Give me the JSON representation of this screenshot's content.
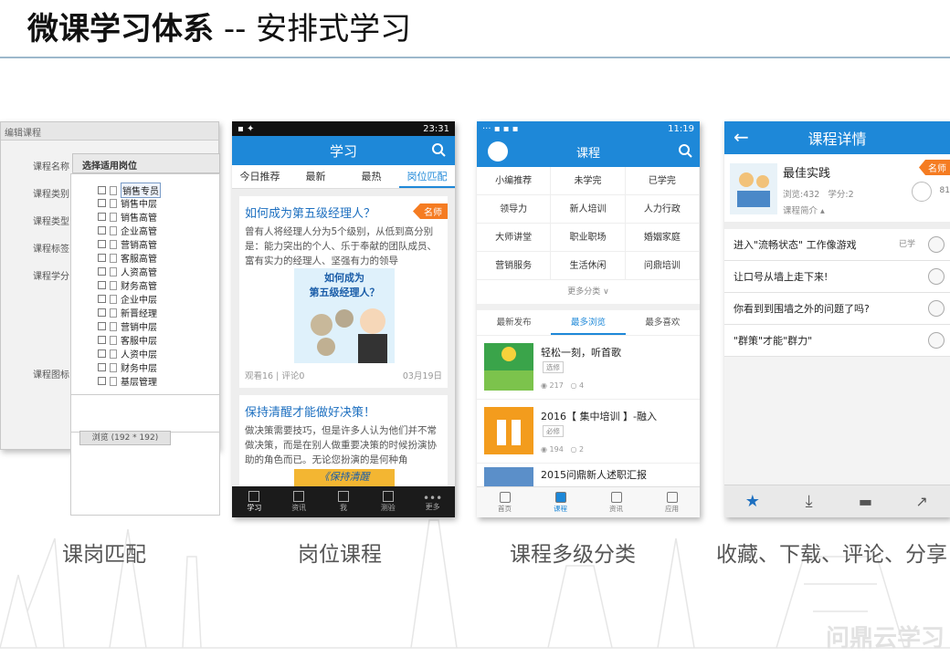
{
  "slide": {
    "title_main": "微课学习体系",
    "title_sub": "-- 安排式学习",
    "captions": [
      "课岗匹配",
      "岗位课程",
      "课程多级分类",
      "收藏、下载、评论、分享"
    ]
  },
  "screen1": {
    "header": "编辑课程",
    "labels": [
      "课程名称",
      "课程类别",
      "课程类型",
      "课程标签",
      "课程学分",
      "课程图标"
    ],
    "select_label": "选择适用岗位",
    "options": [
      "销售专员",
      "销售中层",
      "销售高管",
      "企业高管",
      "营销高管",
      "客服高管",
      "人资高管",
      "财务高管",
      "企业中层",
      "新晋经理",
      "营销中层",
      "客服中层",
      "人资中层",
      "财务中层",
      "基层管理"
    ],
    "browse_label": "浏览 (192 * 192)"
  },
  "screen2": {
    "status_time": "23:31",
    "title": "学习",
    "tabs": [
      "今日推荐",
      "最新",
      "最热",
      "岗位匹配"
    ],
    "active_tab": 3,
    "card1": {
      "title": "如何成为第五级经理人？",
      "badge": "名师",
      "body": "曾有人将经理人分为5个级别，从低到高分别是：能力突出的个人、乐于奉献的团队成员、富有实力的经理人、坚强有力的领导",
      "image_text_1": "如何成为",
      "image_text_2": "第五级经理人？",
      "views": "观看16",
      "comments": "评论0",
      "date": "03月19日"
    },
    "card2": {
      "title": "保持清醒才能做好决策！",
      "body": "做决策需要技巧，但是许多人认为他们并不常做决策，而是在别人做重要决策的时候扮演协助的角色而已。无论您扮演的是何种角",
      "image_text": "《保持清醒"
    },
    "bottom_nav": [
      "学习",
      "资讯",
      "我",
      "测验",
      "更多"
    ]
  },
  "screen3": {
    "status_time": "11:19",
    "title": "课程",
    "categories": [
      "小编推荐",
      "未学完",
      "已学完",
      "领导力",
      "新人培训",
      "人力行政",
      "大师讲堂",
      "职业职场",
      "婚姻家庭",
      "营销服务",
      "生活休闲",
      "问鼎培训"
    ],
    "more": "更多分类",
    "tabs": [
      "最新发布",
      "最多浏览",
      "最多喜欢"
    ],
    "active_tab": 1,
    "items": [
      {
        "title": "轻松一刻，听首歌",
        "tag": "选修",
        "views": "217",
        "comments": "4"
      },
      {
        "title": "2016【 集中培训 】-融入",
        "tag": "必修",
        "views": "194",
        "comments": "2"
      },
      {
        "title": "2015问鼎新人述职汇报",
        "tag": "",
        "views": "",
        "comments": ""
      }
    ],
    "bottom_nav": [
      "首页",
      "课程",
      "资讯",
      "应用"
    ]
  },
  "screen4": {
    "title": "课程详情",
    "course": {
      "name": "最佳实践",
      "badge": "名师",
      "views": "浏览:432",
      "credits": "学分:2",
      "intro": "课程简介",
      "likes": "81"
    },
    "rows": [
      {
        "title": "进入\"流畅状态\" 工作像游戏",
        "status": "已学"
      },
      {
        "title": "让口号从墙上走下来!",
        "status": ""
      },
      {
        "title": "你看到到围墙之外的问题了吗?",
        "status": ""
      },
      {
        "title": "\"群策\"才能\"群力\"",
        "status": ""
      }
    ]
  },
  "watermark": "问鼎云学习",
  "colors": {
    "primary": "#1e88d8",
    "accent": "#f57c22",
    "dark": "#1b1b1b"
  }
}
